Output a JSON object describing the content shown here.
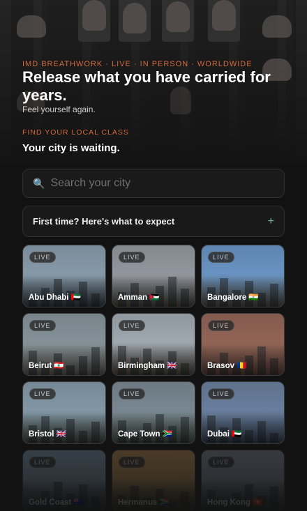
{
  "hero": {
    "eyebrow": "IMD BREATHWORK · LIVE · IN PERSON · WORLDWIDE",
    "headline": "Release what you have carried for years.",
    "subtitle": "Feel yourself again."
  },
  "finder": {
    "label": "FIND YOUR LOCAL CLASS",
    "title": "Your city is waiting.",
    "search_placeholder": "Search your city",
    "search_icon": "magnifier-icon"
  },
  "faq": {
    "question": "First time? Here's what to expect",
    "toggle": "+"
  },
  "badge_label": "LIVE",
  "cities": [
    {
      "name": "Abu Dhabi 🇦🇪",
      "sky": "#8fa3b3",
      "ground": "#3d4a55"
    },
    {
      "name": "Amman 🇯🇴",
      "sky": "#9aa0a8",
      "ground": "#55524c"
    },
    {
      "name": "Bangalore 🇮🇳",
      "sky": "#6f9ccf",
      "ground": "#5c5b50"
    },
    {
      "name": "Beirut 🇱🇧",
      "sky": "#8c9ba2",
      "ground": "#6e6a60"
    },
    {
      "name": "Birmingham 🇬🇧",
      "sky": "#a9b2ba",
      "ground": "#5a5148"
    },
    {
      "name": "Brasov 🇷🇴",
      "sky": "#9a6a5c",
      "ground": "#6a4c42"
    },
    {
      "name": "Bristol 🇬🇧",
      "sky": "#8aa0b0",
      "ground": "#4b5448"
    },
    {
      "name": "Cape Town 🇿🇦",
      "sky": "#7f8f9a",
      "ground": "#4f5a4e"
    },
    {
      "name": "Dubai 🇦🇪",
      "sky": "#6f86a6",
      "ground": "#3e4a5c"
    },
    {
      "name": "Gold Coast 🇦🇺",
      "sky": "#8aa6c0",
      "ground": "#4a5a66"
    },
    {
      "name": "Hermanus 🇿🇦",
      "sky": "#c99a5a",
      "ground": "#5a5a40"
    },
    {
      "name": "Hong Kong 🇭🇰",
      "sky": "#8a98a6",
      "ground": "#4c5560"
    }
  ]
}
